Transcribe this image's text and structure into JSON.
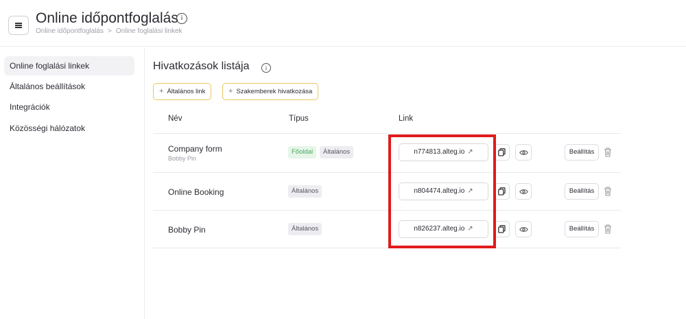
{
  "header": {
    "title": "Online időpontfoglalás",
    "info_icon": "i",
    "breadcrumb": [
      "Online időpontfoglalás",
      ">",
      "Online foglalási linkek"
    ]
  },
  "sidebar": {
    "items": [
      {
        "label": "Online foglalási linkek",
        "active": true
      },
      {
        "label": "Általános beállítások",
        "active": false
      },
      {
        "label": "Integrációk",
        "active": false
      },
      {
        "label": "Közösségi hálózatok",
        "active": false
      }
    ]
  },
  "main": {
    "title": "Hivatkozások listája",
    "info_icon": "i",
    "buttons": [
      {
        "plus": "+",
        "label": "Általános link"
      },
      {
        "plus": "+",
        "label": "Szakemberek hivatkozása"
      }
    ],
    "columns": [
      "Név",
      "Típus",
      "Link"
    ],
    "rows": [
      {
        "name": "Company form",
        "sub": "Bobby Pin",
        "tags": [
          "Főoldal",
          "Általános"
        ],
        "link": "n774813.alteg.io",
        "settings": "Beállítás"
      },
      {
        "name": "Online Booking",
        "sub": "",
        "tags": [
          "Általános"
        ],
        "link": "n804474.alteg.io",
        "settings": "Beállítás"
      },
      {
        "name": "Bobby Pin",
        "sub": "",
        "tags": [
          "Általános"
        ],
        "link": "n826237.alteg.io",
        "settings": "Beállítás"
      }
    ]
  },
  "colors": {
    "accent_border": "#e8c860",
    "highlight": "#e01b1b",
    "tag_green": "#4ca75e"
  },
  "icons": {
    "menu": "hamburger-icon",
    "external": "external-link-icon",
    "copy": "copy-icon",
    "preview": "eye-icon",
    "delete": "trash-icon"
  }
}
